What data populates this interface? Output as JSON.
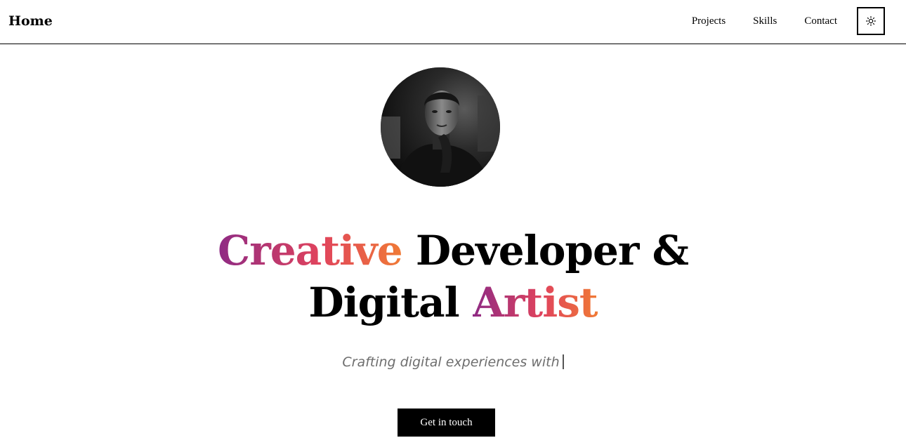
{
  "header": {
    "brand_label": "Home",
    "nav": [
      {
        "label": "Projects"
      },
      {
        "label": "Skills"
      },
      {
        "label": "Contact"
      }
    ],
    "theme_toggle_icon": "sun-icon"
  },
  "hero": {
    "avatar_icon": "profile-photo",
    "headline_part1": "Creative",
    "headline_part2": " Developer &",
    "headline_part3": "Digital ",
    "headline_part4": "Artist",
    "subtitle": "Crafting digital experiences with",
    "cta_label": "Get in touch"
  },
  "colors": {
    "gradient_start": "#8e2a84",
    "gradient_mid": "#e0435d",
    "gradient_end": "#f07a35",
    "cta_background": "#000000",
    "subtitle_text": "#6e6e6e"
  }
}
